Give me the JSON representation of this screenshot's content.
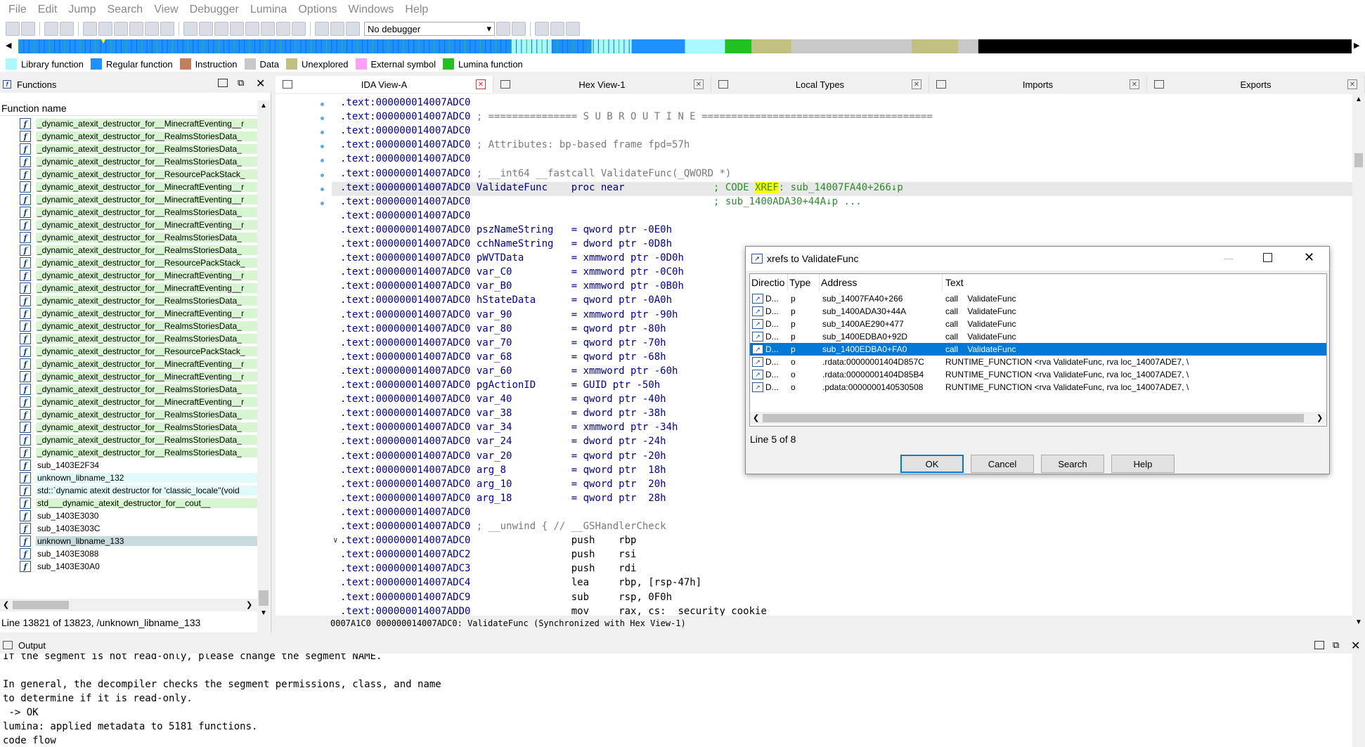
{
  "menu": [
    "File",
    "Edit",
    "Jump",
    "Search",
    "View",
    "Debugger",
    "Lumina",
    "Options",
    "Windows",
    "Help"
  ],
  "toolbar": {
    "debugger_select": "No debugger"
  },
  "legend": [
    {
      "label": "Library function",
      "color": "#a8f8ff"
    },
    {
      "label": "Regular function",
      "color": "#1e90ff"
    },
    {
      "label": "Instruction",
      "color": "#c08060"
    },
    {
      "label": "Data",
      "color": "#c8c8c8"
    },
    {
      "label": "Unexplored",
      "color": "#c0c080"
    },
    {
      "label": "External symbol",
      "color": "#ffa0f8"
    },
    {
      "label": "Lumina function",
      "color": "#22c022"
    }
  ],
  "functions_panel": {
    "title": "Functions",
    "column_header": "Function name",
    "items": [
      {
        "name": "_dynamic_atexit_destructor_for__MinecraftEventing__r",
        "style": "green"
      },
      {
        "name": "_dynamic_atexit_destructor_for__RealmsStoriesData_",
        "style": "green"
      },
      {
        "name": "_dynamic_atexit_destructor_for__RealmsStoriesData_",
        "style": "green"
      },
      {
        "name": "_dynamic_atexit_destructor_for__RealmsStoriesData_",
        "style": "green"
      },
      {
        "name": "_dynamic_atexit_destructor_for__ResourcePackStack_",
        "style": "green"
      },
      {
        "name": "_dynamic_atexit_destructor_for__MinecraftEventing__r",
        "style": "green"
      },
      {
        "name": "_dynamic_atexit_destructor_for__MinecraftEventing__r",
        "style": "green"
      },
      {
        "name": "_dynamic_atexit_destructor_for__RealmsStoriesData_",
        "style": "green"
      },
      {
        "name": "_dynamic_atexit_destructor_for__MinecraftEventing__r",
        "style": "green"
      },
      {
        "name": "_dynamic_atexit_destructor_for__RealmsStoriesData_",
        "style": "green"
      },
      {
        "name": "_dynamic_atexit_destructor_for__RealmsStoriesData_",
        "style": "green"
      },
      {
        "name": "_dynamic_atexit_destructor_for__ResourcePackStack_",
        "style": "green"
      },
      {
        "name": "_dynamic_atexit_destructor_for__MinecraftEventing__r",
        "style": "green"
      },
      {
        "name": "_dynamic_atexit_destructor_for__MinecraftEventing__r",
        "style": "green"
      },
      {
        "name": "_dynamic_atexit_destructor_for__RealmsStoriesData_",
        "style": "green"
      },
      {
        "name": "_dynamic_atexit_destructor_for__MinecraftEventing__r",
        "style": "green"
      },
      {
        "name": "_dynamic_atexit_destructor_for__RealmsStoriesData_",
        "style": "green"
      },
      {
        "name": "_dynamic_atexit_destructor_for__RealmsStoriesData_",
        "style": "green"
      },
      {
        "name": "_dynamic_atexit_destructor_for__ResourcePackStack_",
        "style": "green"
      },
      {
        "name": "_dynamic_atexit_destructor_for__MinecraftEventing__r",
        "style": "green"
      },
      {
        "name": "_dynamic_atexit_destructor_for__MinecraftEventing__r",
        "style": "green"
      },
      {
        "name": "_dynamic_atexit_destructor_for__RealmsStoriesData_",
        "style": "green"
      },
      {
        "name": "_dynamic_atexit_destructor_for__MinecraftEventing__r",
        "style": "green"
      },
      {
        "name": "_dynamic_atexit_destructor_for__RealmsStoriesData_",
        "style": "green"
      },
      {
        "name": "_dynamic_atexit_destructor_for__RealmsStoriesData_",
        "style": "green"
      },
      {
        "name": "_dynamic_atexit_destructor_for__RealmsStoriesData_",
        "style": "green"
      },
      {
        "name": "_dynamic_atexit_destructor_for__RealmsStoriesData_",
        "style": "green"
      },
      {
        "name": "sub_1403E2F34",
        "style": "none"
      },
      {
        "name": "unknown_libname_132",
        "style": "cyan"
      },
      {
        "name": "std::`dynamic atexit destructor for 'classic_locale''(void",
        "style": "cyan"
      },
      {
        "name": "std___dynamic_atexit_destructor_for__cout__",
        "style": "green"
      },
      {
        "name": "sub_1403E3030",
        "style": "none"
      },
      {
        "name": "sub_1403E303C",
        "style": "none"
      },
      {
        "name": "unknown_libname_133",
        "style": "sel"
      },
      {
        "name": "sub_1403E3088",
        "style": "none"
      },
      {
        "name": "sub_1403E30A0",
        "style": "none"
      }
    ],
    "status": "Line 13821 of 13823, /unknown_libname_133"
  },
  "tabs": [
    {
      "label": "IDA View-A",
      "active": true
    },
    {
      "label": "Hex View-1",
      "active": false
    },
    {
      "label": "Local Types",
      "active": false
    },
    {
      "label": "Imports",
      "active": false
    },
    {
      "label": "Exports",
      "active": false
    }
  ],
  "disasm": {
    "lines": [
      {
        "seg": ".text:000000014007ADC0",
        "rest": "",
        "cls": ""
      },
      {
        "seg": ".text:000000014007ADC0",
        "rest": " ; =============== S U B R O U T I N E =======================================",
        "cls": "cm"
      },
      {
        "seg": ".text:000000014007ADC0",
        "rest": "",
        "cls": ""
      },
      {
        "seg": ".text:000000014007ADC0",
        "rest": " ; Attributes: bp-based frame fpd=57h",
        "cls": "cm"
      },
      {
        "seg": ".text:000000014007ADC0",
        "rest": "",
        "cls": ""
      },
      {
        "seg": ".text:000000014007ADC0",
        "rest": " ; __int64 __fastcall ValidateFunc(_QWORD *)",
        "cls": "cm"
      },
      {
        "seg": ".text:000000014007ADC0",
        "rest": "",
        "cls": "xrefline"
      },
      {
        "seg": ".text:000000014007ADC0",
        "rest": "                                         ; sub_1400ADA30+44A↓p ...",
        "cls": "cmg"
      },
      {
        "seg": ".text:000000014007ADC0",
        "rest": "",
        "cls": ""
      },
      {
        "seg": ".text:000000014007ADC0",
        "rest": " pszNameString   = qword ptr -0E0h",
        "cls": "nm"
      },
      {
        "seg": ".text:000000014007ADC0",
        "rest": " cchNameString   = dword ptr -0D8h",
        "cls": "nm"
      },
      {
        "seg": ".text:000000014007ADC0",
        "rest": " pWVTData        = xmmword ptr -0D0h",
        "cls": "nm"
      },
      {
        "seg": ".text:000000014007ADC0",
        "rest": " var_C0          = xmmword ptr -0C0h",
        "cls": "nm"
      },
      {
        "seg": ".text:000000014007ADC0",
        "rest": " var_B0          = xmmword ptr -0B0h",
        "cls": "nm"
      },
      {
        "seg": ".text:000000014007ADC0",
        "rest": " hStateData      = qword ptr -0A0h",
        "cls": "nm"
      },
      {
        "seg": ".text:000000014007ADC0",
        "rest": " var_90          = xmmword ptr -90h",
        "cls": "nm"
      },
      {
        "seg": ".text:000000014007ADC0",
        "rest": " var_80          = qword ptr -80h",
        "cls": "nm"
      },
      {
        "seg": ".text:000000014007ADC0",
        "rest": " var_70          = qword ptr -70h",
        "cls": "nm"
      },
      {
        "seg": ".text:000000014007ADC0",
        "rest": " var_68          = qword ptr -68h",
        "cls": "nm"
      },
      {
        "seg": ".text:000000014007ADC0",
        "rest": " var_60          = xmmword ptr -60h",
        "cls": "nm"
      },
      {
        "seg": ".text:000000014007ADC0",
        "rest": " pgActionID      = GUID ptr -50h",
        "cls": "nm"
      },
      {
        "seg": ".text:000000014007ADC0",
        "rest": " var_40          = qword ptr -40h",
        "cls": "nm"
      },
      {
        "seg": ".text:000000014007ADC0",
        "rest": " var_38          = dword ptr -38h",
        "cls": "nm"
      },
      {
        "seg": ".text:000000014007ADC0",
        "rest": " var_34          = xmmword ptr -34h",
        "cls": "nm"
      },
      {
        "seg": ".text:000000014007ADC0",
        "rest": " var_24          = dword ptr -24h",
        "cls": "nm"
      },
      {
        "seg": ".text:000000014007ADC0",
        "rest": " var_20          = qword ptr -20h",
        "cls": "nm"
      },
      {
        "seg": ".text:000000014007ADC0",
        "rest": " arg_8           = qword ptr  18h",
        "cls": "nm"
      },
      {
        "seg": ".text:000000014007ADC0",
        "rest": " arg_10          = qword ptr  20h",
        "cls": "nm"
      },
      {
        "seg": ".text:000000014007ADC0",
        "rest": " arg_18          = qword ptr  28h",
        "cls": "nm"
      },
      {
        "seg": ".text:000000014007ADC0",
        "rest": "",
        "cls": ""
      },
      {
        "seg": ".text:000000014007ADC0",
        "rest": " ; __unwind { // __GSHandlerCheck",
        "cls": "cm"
      },
      {
        "seg": ".text:000000014007ADC0",
        "rest": "                 push    rbp",
        "cls": "ins"
      },
      {
        "seg": ".text:000000014007ADC2",
        "rest": "                 push    rsi",
        "cls": "ins"
      },
      {
        "seg": ".text:000000014007ADC3",
        "rest": "                 push    rdi",
        "cls": "ins"
      },
      {
        "seg": ".text:000000014007ADC4",
        "rest": "                 lea     rbp, [rsp-47h]",
        "cls": "ins"
      },
      {
        "seg": ".text:000000014007ADC9",
        "rest": "                 sub     rsp, 0F0h",
        "cls": "ins"
      },
      {
        "seg": ".text:000000014007ADD0",
        "rest": "                 mov     rax, cs:__security_cookie",
        "cls": "ins"
      }
    ],
    "xref_line": {
      "name": " ValidateFunc    proc near               ",
      "comment_pre": "; CODE ",
      "comment_hl": "XREF",
      "comment_post": ": sub_14007FA40+266↓p"
    },
    "status": "0007A1C0 000000014007ADC0: ValidateFunc (Synchronized with Hex View-1)"
  },
  "output": {
    "title": "Output",
    "lines": [
      "If the segment is not read-only, please change the segment NAME.",
      "",
      "In general, the decompiler checks the segment permissions, class, and name",
      "to determine if it is read-only.",
      " -> OK",
      "lumina: applied metadata to 5181 functions.",
      "code flow"
    ]
  },
  "dialog": {
    "title": "xrefs to ValidateFunc",
    "columns": [
      "Directio",
      "Type",
      "Address",
      "Text"
    ],
    "rows": [
      {
        "dir": "D...",
        "type": "p",
        "address": "sub_14007FA40+266",
        "text": "call    ValidateFunc"
      },
      {
        "dir": "D...",
        "type": "p",
        "address": "sub_1400ADA30+44A",
        "text": "call    ValidateFunc"
      },
      {
        "dir": "D...",
        "type": "p",
        "address": "sub_1400AE290+477",
        "text": "call    ValidateFunc"
      },
      {
        "dir": "D...",
        "type": "p",
        "address": "sub_1400EDBA0+92D",
        "text": "call    ValidateFunc"
      },
      {
        "dir": "D...",
        "type": "p",
        "address": "sub_1400EDBA0+FA0",
        "text": "call    ValidateFunc"
      },
      {
        "dir": "D...",
        "type": "o",
        "address": ".rdata:00000001404D857C",
        "text": "RUNTIME_FUNCTION <rva ValidateFunc, rva loc_14007ADE7, \\"
      },
      {
        "dir": "D...",
        "type": "o",
        "address": ".rdata:00000001404D85B4",
        "text": "RUNTIME_FUNCTION <rva ValidateFunc, rva loc_14007ADE7, \\"
      },
      {
        "dir": "D...",
        "type": "o",
        "address": ".pdata:0000000140530508",
        "text": "RUNTIME_FUNCTION <rva ValidateFunc, rva loc_14007ADE7, \\"
      }
    ],
    "selected_index": 4,
    "line_status": "Line 5 of 8",
    "buttons": {
      "ok": "OK",
      "cancel": "Cancel",
      "search": "Search",
      "help": "Help"
    }
  }
}
